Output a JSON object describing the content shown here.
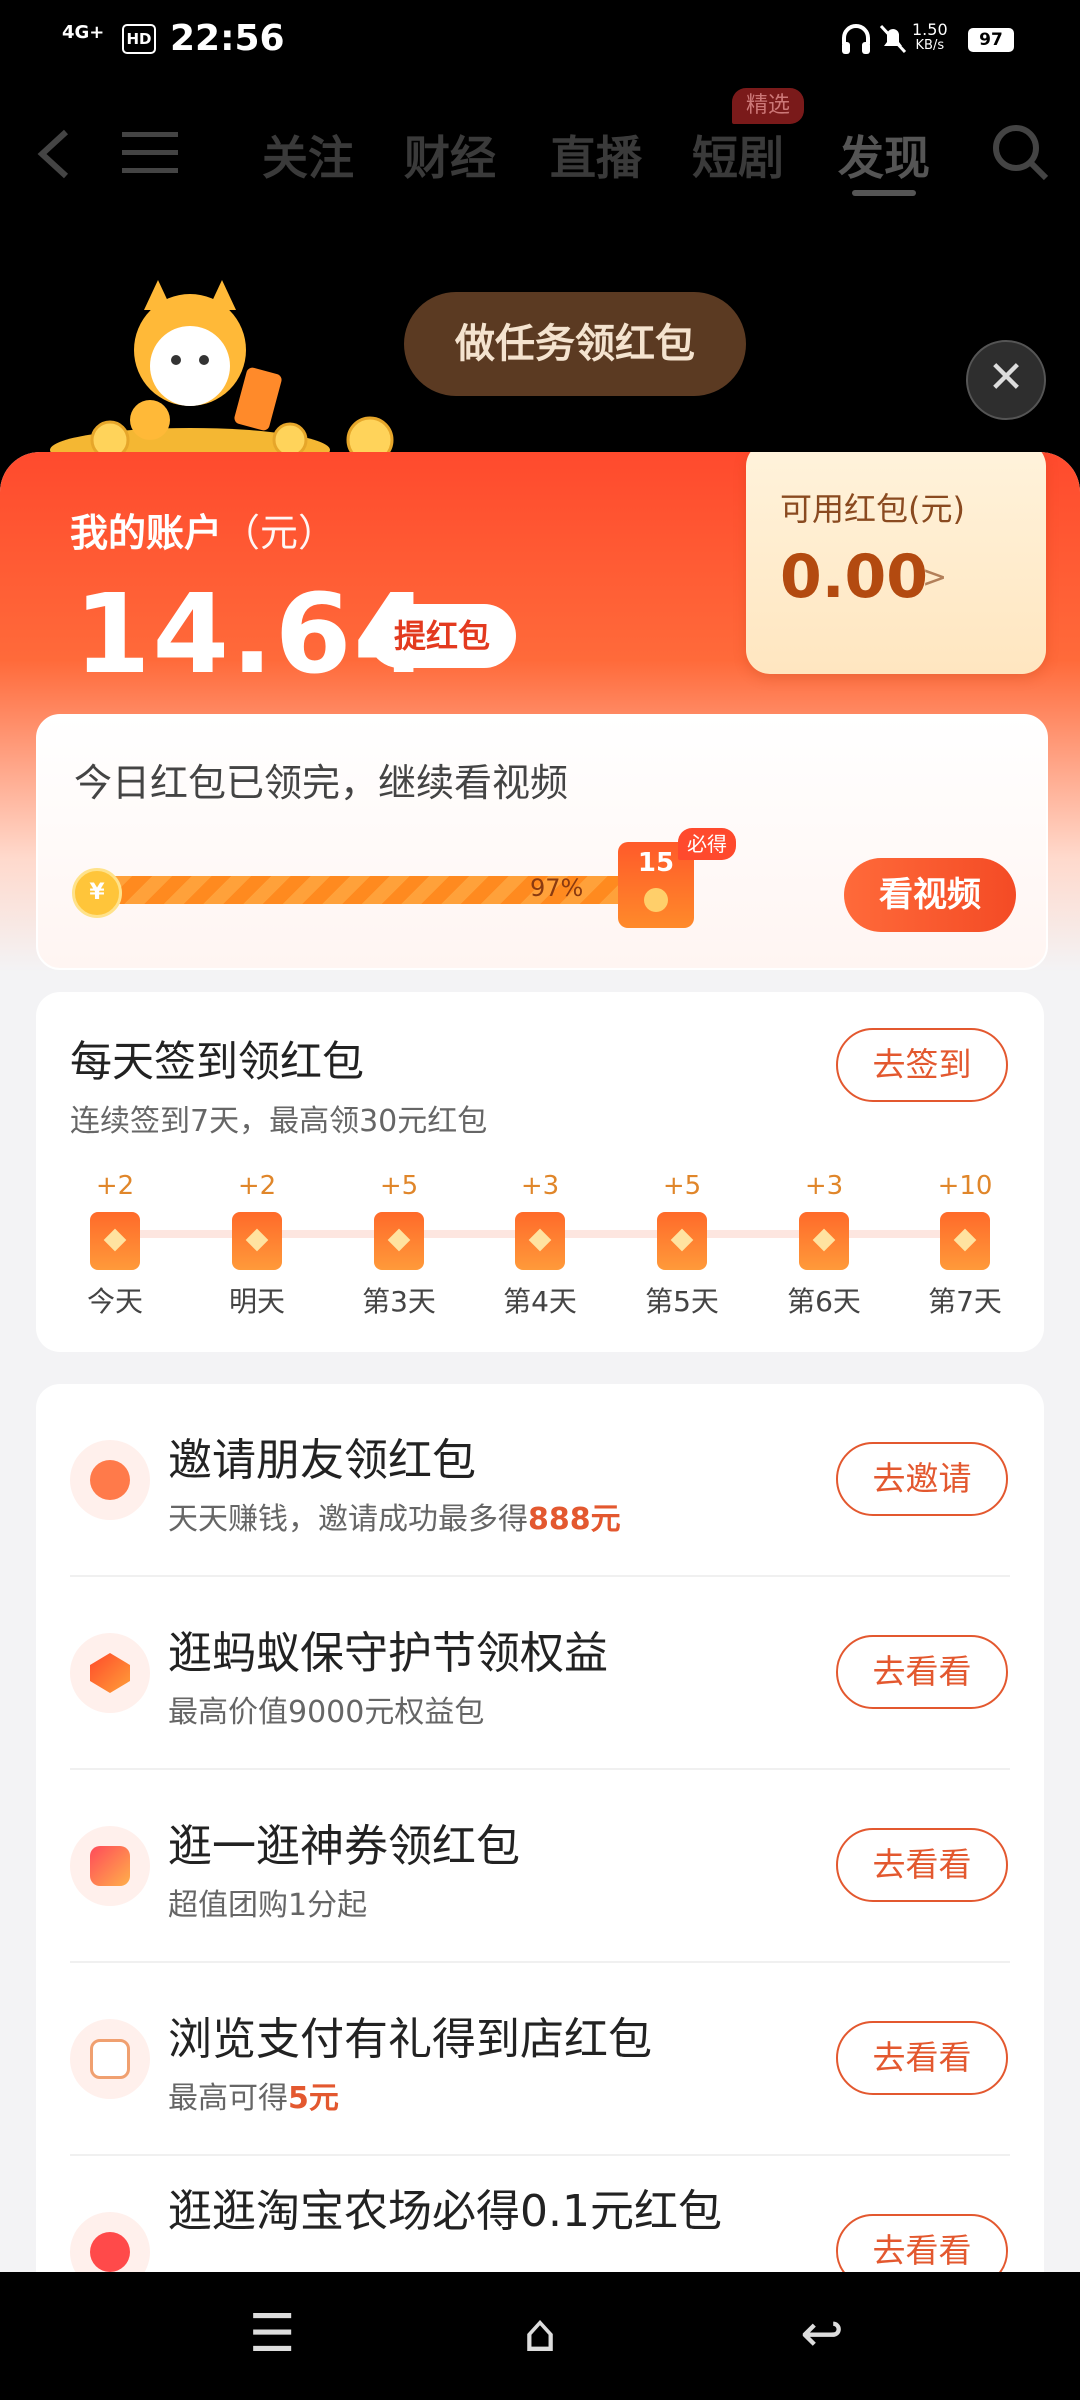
{
  "status_bar": {
    "network": "4G+",
    "hd": "HD",
    "time": "22:56",
    "speed": "1.50\nKB/s",
    "speed_value": "1.50",
    "speed_unit": "KB/s",
    "battery": "97"
  },
  "top_nav": {
    "tabs": [
      "关注",
      "财经",
      "直播",
      "短剧",
      "发现"
    ],
    "active_tab": "发现",
    "badge": "精选"
  },
  "overlay": {
    "bubble_text": "做任务领红包",
    "close_symbol": "✕"
  },
  "account": {
    "title": "我的账户",
    "unit": "（元）",
    "balance": "14.64",
    "withdraw_label": "提红包",
    "redpack_label": "可用红包(元)",
    "redpack_value": "0.00",
    "redpack_arrow": ">"
  },
  "watch": {
    "message": "今日红包已领完，继续看视频",
    "progress_percent": 97,
    "progress_label": "97%",
    "coin_symbol": "¥",
    "gift_count": "15",
    "must_get": "必得",
    "button": "看视频"
  },
  "signin": {
    "title": "每天签到领红包",
    "subtitle": "连续签到7天，最高领30元红包",
    "button": "去签到",
    "days": [
      {
        "points": "+2",
        "label": "今天"
      },
      {
        "points": "+2",
        "label": "明天"
      },
      {
        "points": "+5",
        "label": "第3天"
      },
      {
        "points": "+3",
        "label": "第4天"
      },
      {
        "points": "+5",
        "label": "第5天"
      },
      {
        "points": "+3",
        "label": "第6天"
      },
      {
        "points": "+10",
        "label": "第7天"
      }
    ]
  },
  "tasks": [
    {
      "title": "邀请朋友领红包",
      "sub_prefix": "天天赚钱，邀请成功最多得",
      "sub_highlight": "888元",
      "button": "去邀请",
      "icon": "friends-icon",
      "color": "#ff7a4a"
    },
    {
      "title": "逛蚂蚁保守护节领权益",
      "sub_prefix": "最高价值9000元权益包",
      "sub_highlight": "",
      "button": "去看看",
      "icon": "shield-icon",
      "color": "#ff6a3a"
    },
    {
      "title": "逛一逛神券领红包",
      "sub_prefix": "超值团购1分起",
      "sub_highlight": "",
      "button": "去看看",
      "icon": "coupon-icon",
      "color": "#ff5a5a"
    },
    {
      "title": "浏览支付有礼得到店红包",
      "sub_prefix": "最高可得",
      "sub_highlight": "5元",
      "button": "去看看",
      "icon": "cup-icon",
      "color": "#f0a070"
    },
    {
      "title": "逛逛淘宝农场必得0.1元红包",
      "sub_prefix": "",
      "sub_highlight": "",
      "button": "去看看",
      "icon": "farm-icon",
      "color": "#ff4a4a"
    }
  ],
  "nav_bar": {
    "menu": "☰",
    "home": "⌂",
    "back": "↩"
  }
}
